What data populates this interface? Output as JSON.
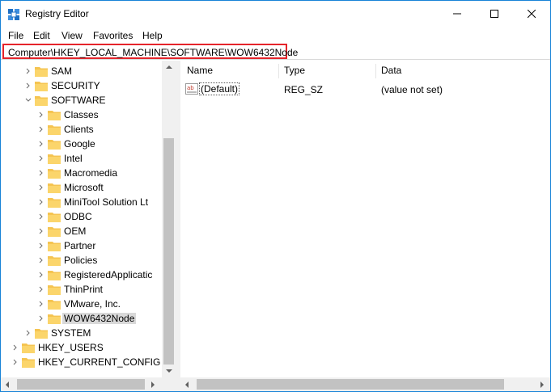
{
  "window": {
    "title": "Registry Editor"
  },
  "menu": [
    "File",
    "Edit",
    "View",
    "Favorites",
    "Help"
  ],
  "address": {
    "path": "Computer\\HKEY_LOCAL_MACHINE\\SOFTWARE\\WOW6432Node"
  },
  "tree": {
    "items": [
      {
        "label": "SAM",
        "level": 2,
        "expanded": false,
        "selected": false
      },
      {
        "label": "SECURITY",
        "level": 2,
        "expanded": false,
        "selected": false
      },
      {
        "label": "SOFTWARE",
        "level": 2,
        "expanded": true,
        "selected": false
      },
      {
        "label": "Classes",
        "level": 3,
        "expanded": false,
        "selected": false
      },
      {
        "label": "Clients",
        "level": 3,
        "expanded": false,
        "selected": false
      },
      {
        "label": "Google",
        "level": 3,
        "expanded": false,
        "selected": false
      },
      {
        "label": "Intel",
        "level": 3,
        "expanded": false,
        "selected": false
      },
      {
        "label": "Macromedia",
        "level": 3,
        "expanded": false,
        "selected": false
      },
      {
        "label": "Microsoft",
        "level": 3,
        "expanded": false,
        "selected": false
      },
      {
        "label": "MiniTool Solution Lt",
        "level": 3,
        "expanded": false,
        "selected": false
      },
      {
        "label": "ODBC",
        "level": 3,
        "expanded": false,
        "selected": false
      },
      {
        "label": "OEM",
        "level": 3,
        "expanded": false,
        "selected": false
      },
      {
        "label": "Partner",
        "level": 3,
        "expanded": false,
        "selected": false
      },
      {
        "label": "Policies",
        "level": 3,
        "expanded": false,
        "selected": false
      },
      {
        "label": "RegisteredApplicatic",
        "level": 3,
        "expanded": false,
        "selected": false
      },
      {
        "label": "ThinPrint",
        "level": 3,
        "expanded": false,
        "selected": false
      },
      {
        "label": "VMware, Inc.",
        "level": 3,
        "expanded": false,
        "selected": false
      },
      {
        "label": "WOW6432Node",
        "level": 3,
        "expanded": false,
        "selected": true
      },
      {
        "label": "SYSTEM",
        "level": 2,
        "expanded": false,
        "selected": false
      },
      {
        "label": "HKEY_USERS",
        "level": 1,
        "expanded": false,
        "selected": false
      },
      {
        "label": "HKEY_CURRENT_CONFIG",
        "level": 1,
        "expanded": false,
        "selected": false
      }
    ]
  },
  "values": {
    "columns": [
      "Name",
      "Type",
      "Data"
    ],
    "rows": [
      {
        "name": "(Default)",
        "type": "REG_SZ",
        "data": "(value not set)"
      }
    ]
  },
  "colors": {
    "accent": "#1883d7",
    "highlight_border": "#e5242b",
    "folder": "#f5c451",
    "selection": "#d9d9d9"
  }
}
